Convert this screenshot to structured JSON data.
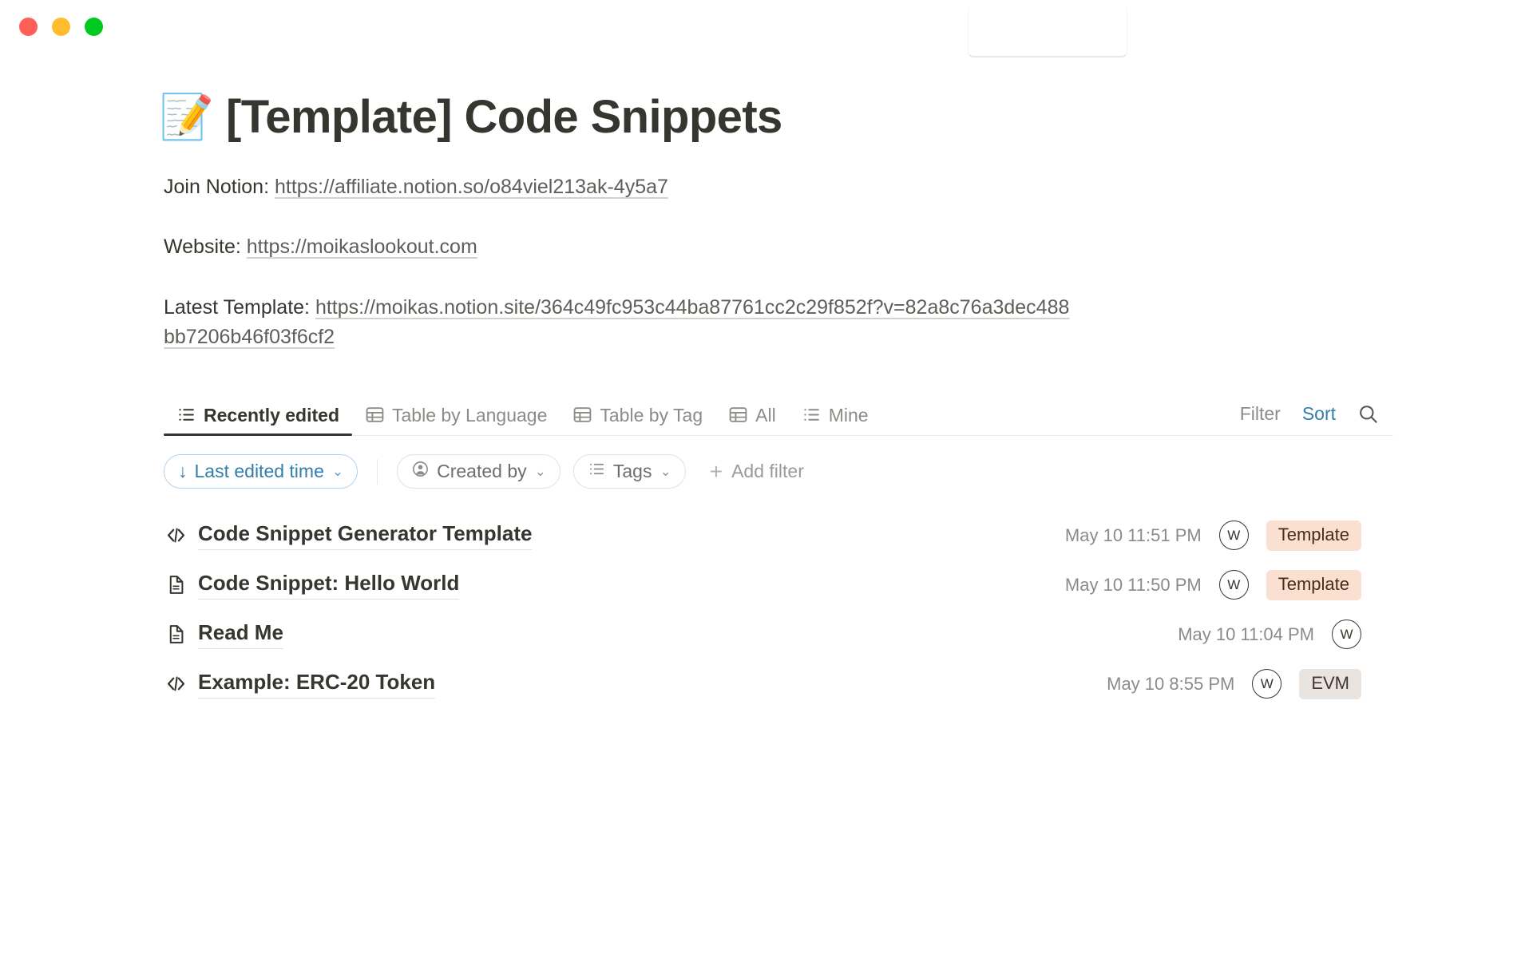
{
  "window": {
    "traffic_lights": [
      {
        "name": "close",
        "color": "#ff5f57"
      },
      {
        "name": "minimize",
        "color": "#ffbd2e"
      },
      {
        "name": "maximize",
        "color": "#00c91f"
      }
    ]
  },
  "header": {
    "emoji": "📝",
    "title": "[Template] Code Snippets"
  },
  "paragraphs": [
    {
      "label": "Join Notion: ",
      "link": "https://affiliate.notion.so/o84viel213ak-4y5a7"
    },
    {
      "label": "Website: ",
      "link": "https://moikaslookout.com"
    },
    {
      "label": "Latest Template: ",
      "link": "https://moikas.notion.site/364c49fc953c44ba87761cc2c29f852f?v=82a8c76a3dec488bb7206b46f03f6cf2"
    }
  ],
  "views": {
    "tabs": [
      {
        "label": "Recently edited",
        "icon": "list-view-icon",
        "active": true
      },
      {
        "label": "Table by Language",
        "icon": "table-view-icon",
        "active": false
      },
      {
        "label": "Table by Tag",
        "icon": "table-view-icon",
        "active": false
      },
      {
        "label": "All",
        "icon": "table-view-icon",
        "active": false
      },
      {
        "label": "Mine",
        "icon": "list-view-icon",
        "active": false
      }
    ],
    "filter_label": "Filter",
    "sort_label": "Sort",
    "search_icon": "search-icon",
    "accent_color": "#337ea9"
  },
  "filters": {
    "sort_chip": {
      "label": "Last edited time",
      "arrow": "↓",
      "chevron": "⌄"
    },
    "chips": [
      {
        "label": "Created by",
        "icon": "person-icon",
        "chevron": "⌄"
      },
      {
        "label": "Tags",
        "icon": "list-icon",
        "chevron": "⌄"
      }
    ],
    "add_filter_label": "Add filter",
    "add_filter_icon": "plus-icon"
  },
  "rows": [
    {
      "icon": "code-icon",
      "title": "Code Snippet Generator Template",
      "date": "May 10 11:51 PM",
      "avatar": "W",
      "tag": "Template",
      "tag_bg": "#fae0d0",
      "tag_fg": "#4b2a17"
    },
    {
      "icon": "page-icon",
      "title": "Code Snippet: Hello World",
      "date": "May 10 11:50 PM",
      "avatar": "W",
      "tag": "Template",
      "tag_bg": "#fae0d0",
      "tag_fg": "#4b2a17"
    },
    {
      "icon": "page-icon",
      "title": "Read Me",
      "date": "May 10 11:04 PM",
      "avatar": "W",
      "tag": "",
      "tag_bg": "",
      "tag_fg": ""
    },
    {
      "icon": "code-icon",
      "title": "Example: ERC-20 Token",
      "date": "May 10 8:55 PM",
      "avatar": "W",
      "tag": "EVM",
      "tag_bg": "#eae4e0",
      "tag_fg": "#43352e"
    }
  ]
}
